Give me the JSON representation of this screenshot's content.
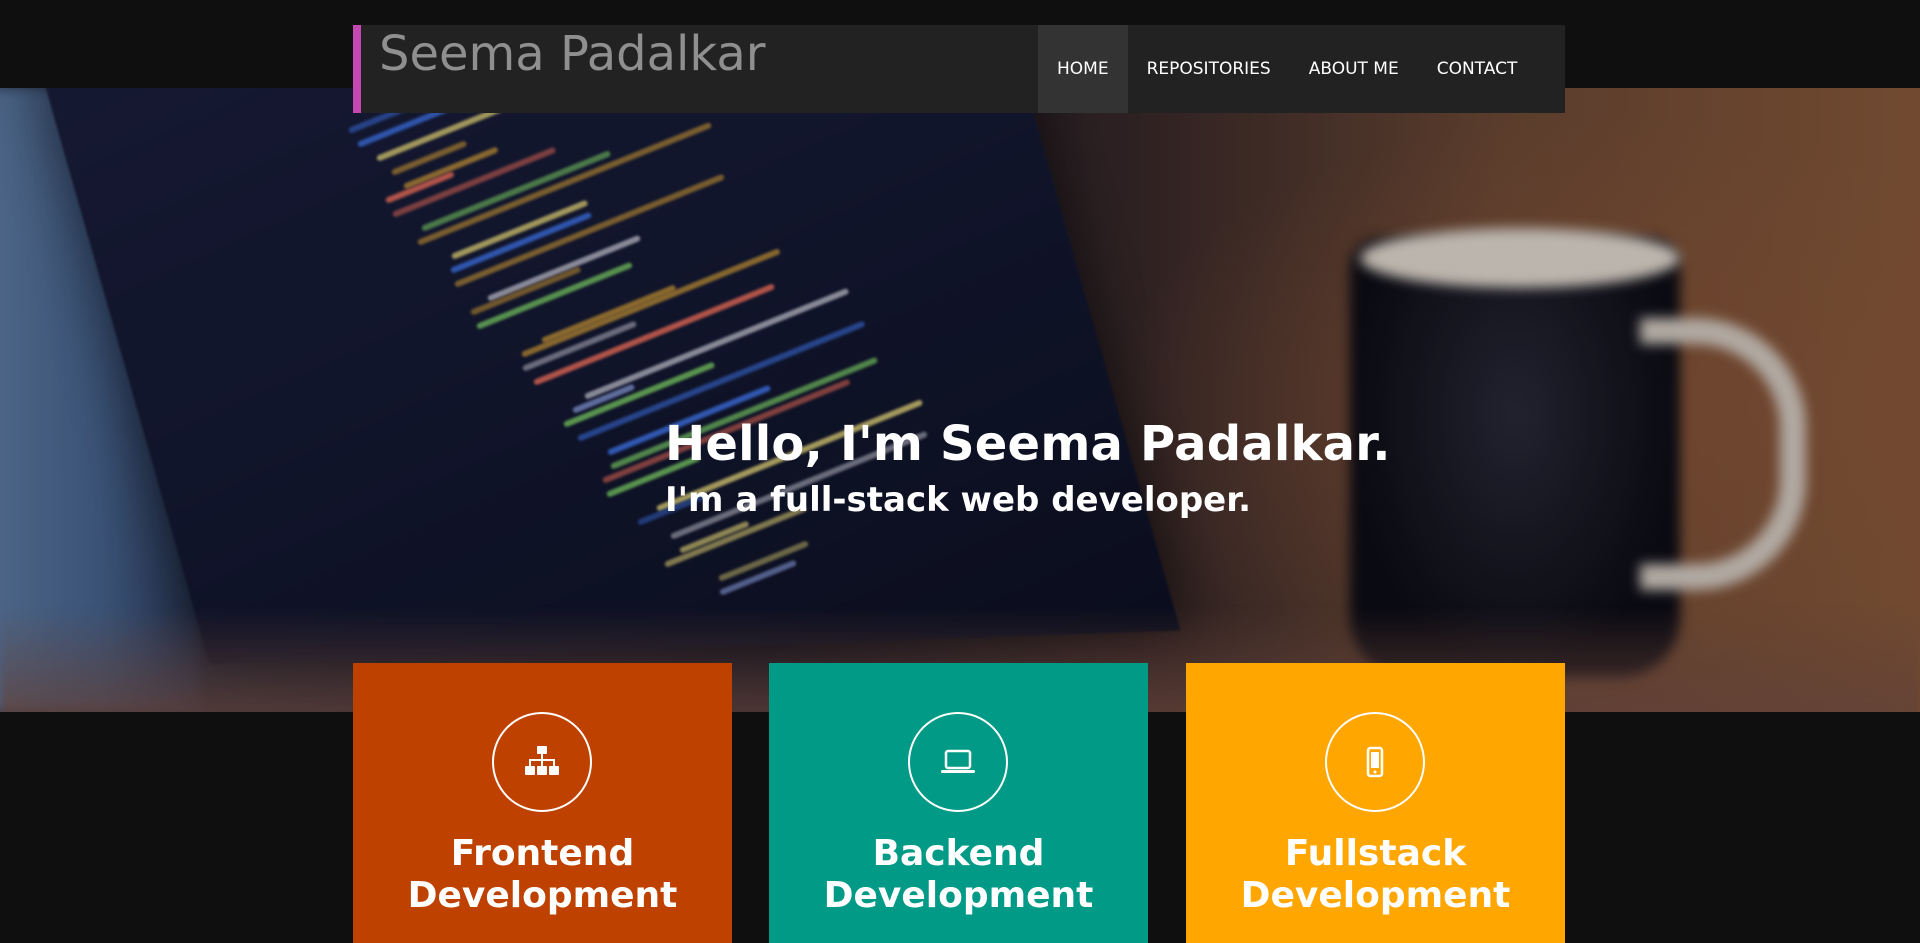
{
  "brand": {
    "name": "Seema Padalkar",
    "accent_color": "#c548b2"
  },
  "nav": {
    "items": [
      {
        "label": "HOME",
        "active": true
      },
      {
        "label": "REPOSITORIES",
        "active": false
      },
      {
        "label": "ABOUT ME",
        "active": false
      },
      {
        "label": "CONTACT",
        "active": false
      }
    ]
  },
  "hero": {
    "headline": "Hello, I'm Seema Padalkar.",
    "subheadline": "I'm a full-stack web developer."
  },
  "cards": [
    {
      "title": "Frontend\nDevelopment",
      "icon": "sitemap-icon",
      "color": "#bf4100"
    },
    {
      "title": "Backend\nDevelopment",
      "icon": "laptop-icon",
      "color": "#009a86"
    },
    {
      "title": "Fullstack\nDevelopment",
      "icon": "mobile-phone-icon",
      "color": "#ffa600"
    }
  ]
}
